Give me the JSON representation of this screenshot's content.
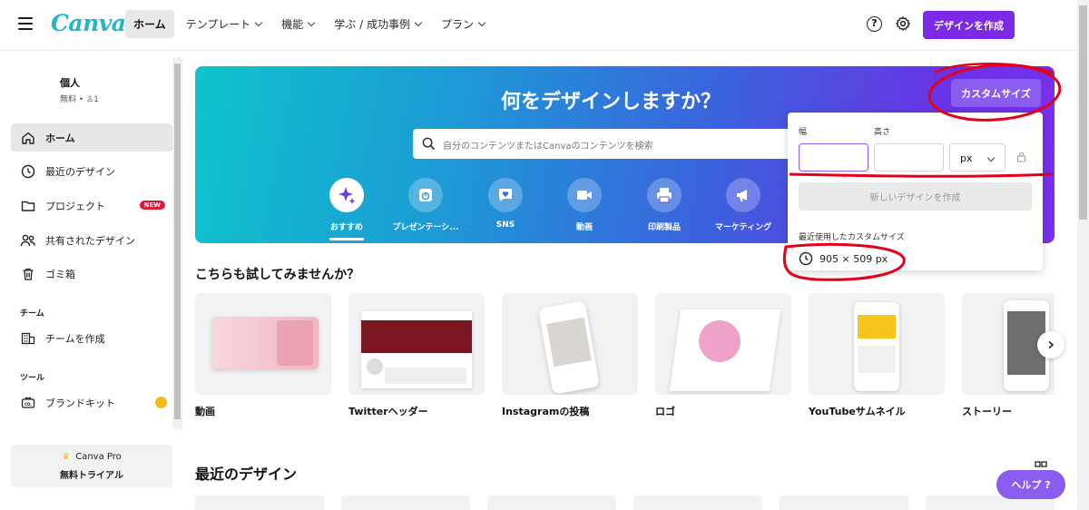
{
  "header": {
    "logo": "Canva",
    "nav": [
      {
        "label": "ホーム",
        "active": true
      },
      {
        "label": "テンプレート",
        "dropdown": true
      },
      {
        "label": "機能",
        "dropdown": true
      },
      {
        "label": "学ぶ / 成功事例",
        "dropdown": true
      },
      {
        "label": "プラン",
        "dropdown": true
      }
    ],
    "help_icon": "?",
    "create_button": "デザインを作成"
  },
  "sidebar": {
    "profile_name": "個人",
    "profile_sub": "無料 • ♙1",
    "items": [
      {
        "label": "ホーム"
      },
      {
        "label": "最近のデザイン"
      },
      {
        "label": "プロジェクト",
        "badge": "NEW"
      },
      {
        "label": "共有されたデザイン"
      },
      {
        "label": "ゴミ箱"
      }
    ],
    "team_section": "チーム",
    "team_items": [
      {
        "label": "チームを作成"
      }
    ],
    "tools_section": "ツール",
    "tools_items": [
      {
        "label": "ブランドキット"
      }
    ],
    "pro_line1": "Canva Pro",
    "pro_line2": "無料トライアル"
  },
  "hero": {
    "title": "何をデザインしますか？",
    "search_placeholder": "自分のコンテンツまたはCanvaのコンテンツを検索",
    "custom_size_button": "カスタムサイズ",
    "categories": [
      {
        "label": "おすすめ",
        "icon": "sparkle-icon",
        "active": true
      },
      {
        "label": "プレゼンテーシ...",
        "icon": "presentation-icon"
      },
      {
        "label": "SNS",
        "icon": "heart-chat-icon"
      },
      {
        "label": "動画",
        "icon": "video-camera-icon"
      },
      {
        "label": "印刷製品",
        "icon": "printer-icon"
      },
      {
        "label": "マーケティング",
        "icon": "megaphone-icon"
      }
    ]
  },
  "custom_size_popover": {
    "width_label": "幅",
    "height_label": "高さ",
    "width_value": "",
    "height_value": "",
    "unit": "px",
    "create_button": "新しいデザインを作成",
    "recent_label": "最近使用したカスタムサイズ",
    "recent_item": "905 × 509 px"
  },
  "try_section": {
    "title": "こちらも試してみませんか？",
    "cards": [
      {
        "label": "動画"
      },
      {
        "label": "Twitterヘッダー"
      },
      {
        "label": "Instagramの投稿"
      },
      {
        "label": "ロゴ"
      },
      {
        "label": "YouTubeサムネイル"
      },
      {
        "label": "ストーリー"
      }
    ]
  },
  "recent_section": {
    "title": "最近のデザイン"
  },
  "help_button": "ヘルプ ?",
  "colors": {
    "brand_purple": "#7d2ae8",
    "annotation_red": "#e3001b",
    "hero_start": "#0ec4cc",
    "hero_end": "#7b2ff0"
  }
}
